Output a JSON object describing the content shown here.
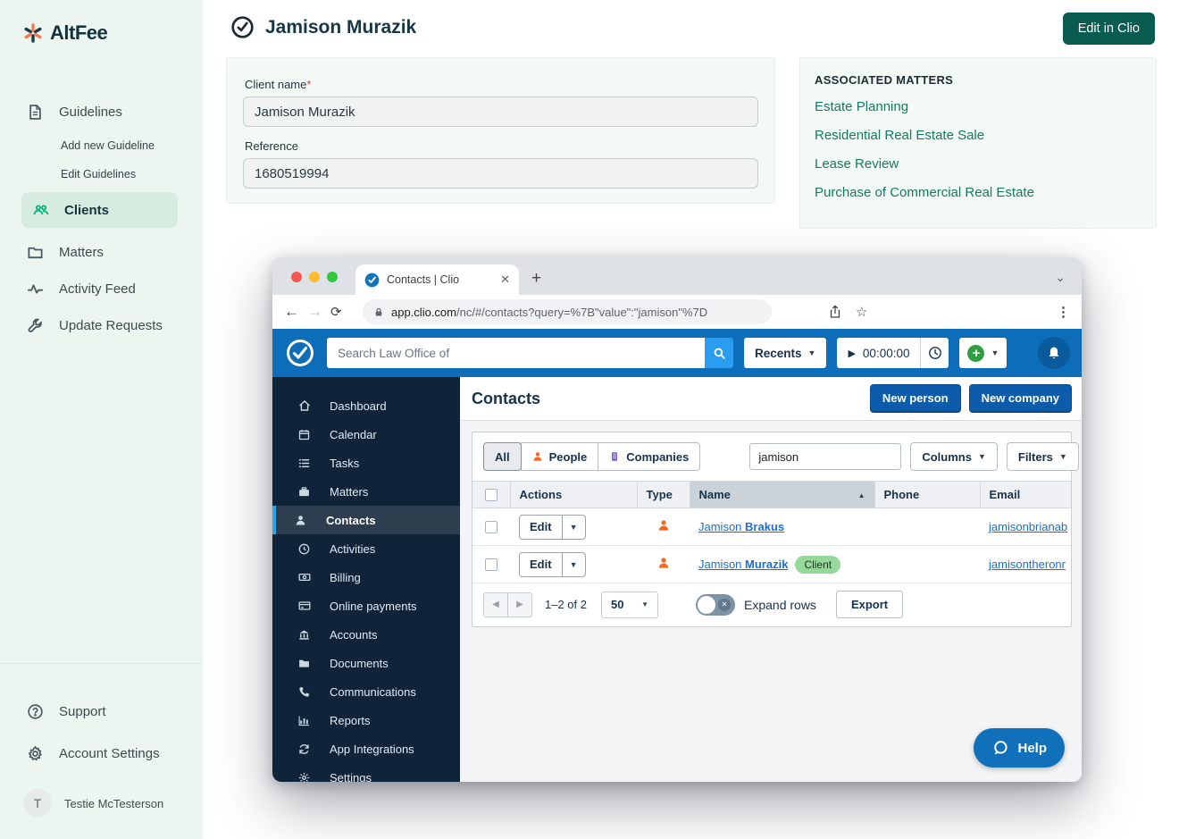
{
  "colors": {
    "altfee_green": "#12b380",
    "altfee_dark_teal": "#0b5c50",
    "clio_blue": "#0d6db8",
    "clio_button_blue": "#0d5cab",
    "link_blue": "#1a6fd4",
    "client_badge_green": "#96d89a",
    "type_icon_orange": "#f2691f",
    "companies_icon_purple": "#7a55d6"
  },
  "altfee": {
    "brand": "AltFee",
    "nav": [
      {
        "label": "Guidelines"
      },
      {
        "label": "Add new Guideline"
      },
      {
        "label": "Edit Guidelines"
      },
      {
        "label": "Clients"
      },
      {
        "label": "Matters"
      },
      {
        "label": "Activity Feed"
      },
      {
        "label": "Update Requests"
      }
    ],
    "footer": {
      "support": "Support",
      "account_settings": "Account Settings"
    },
    "user": {
      "initial": "T",
      "name": "Testie McTesterson"
    }
  },
  "page": {
    "title": "Jamison Murazik",
    "edit_button": "Edit in Clio",
    "form": {
      "client_name_label": "Client name",
      "required_mark": "*",
      "client_name_value": "Jamison Murazik",
      "reference_label": "Reference",
      "reference_value": "1680519994"
    },
    "matters": {
      "heading": "ASSOCIATED MATTERS",
      "items": [
        "Estate Planning",
        "Residential Real Estate Sale",
        "Lease Review",
        "Purchase of Commercial Real Estate"
      ]
    }
  },
  "browser": {
    "tab_title": "Contacts | Clio",
    "close_tab": "✕",
    "new_tab": "+",
    "url_domain": "app.clio.com",
    "url_path": "/nc/#/contacts?query=%7B\"value\":\"jamison\"%7D",
    "back": "←",
    "forward": "→",
    "reload": "⟳",
    "star": "☆",
    "menu_dots": "⋮",
    "chevron": "⌄"
  },
  "clio": {
    "search_placeholder": "Search Law Office of",
    "recents_label": "Recents",
    "timer_value": "00:00:00",
    "nav": [
      {
        "label": "Dashboard"
      },
      {
        "label": "Calendar"
      },
      {
        "label": "Tasks"
      },
      {
        "label": "Matters"
      },
      {
        "label": "Contacts"
      },
      {
        "label": "Activities"
      },
      {
        "label": "Billing"
      },
      {
        "label": "Online payments"
      },
      {
        "label": "Accounts"
      },
      {
        "label": "Documents"
      },
      {
        "label": "Communications"
      },
      {
        "label": "Reports"
      },
      {
        "label": "App Integrations"
      },
      {
        "label": "Settings"
      }
    ],
    "page_title": "Contacts",
    "new_person": "New person",
    "new_company": "New company",
    "filter_tabs": {
      "all": "All",
      "people": "People",
      "companies": "Companies"
    },
    "contact_search_value": "jamison",
    "columns_label": "Columns",
    "filters_label": "Filters",
    "table": {
      "headers": [
        "Actions",
        "Type",
        "Name",
        "Phone",
        "Email"
      ],
      "sort_arrow": "▲",
      "rows": [
        {
          "edit": "Edit",
          "name_first": "Jamison ",
          "name_last": "Brakus",
          "badge": "",
          "phone": "",
          "email": "jamisonbrianab"
        },
        {
          "edit": "Edit",
          "name_first": "Jamison ",
          "name_last": "Murazik",
          "badge": "Client",
          "phone": "",
          "email": "jamisontheronr"
        }
      ]
    },
    "pagination": {
      "range": "1–2 of 2",
      "page_size": "50",
      "expand_label": "Expand rows",
      "export_label": "Export"
    },
    "help_label": "Help"
  }
}
